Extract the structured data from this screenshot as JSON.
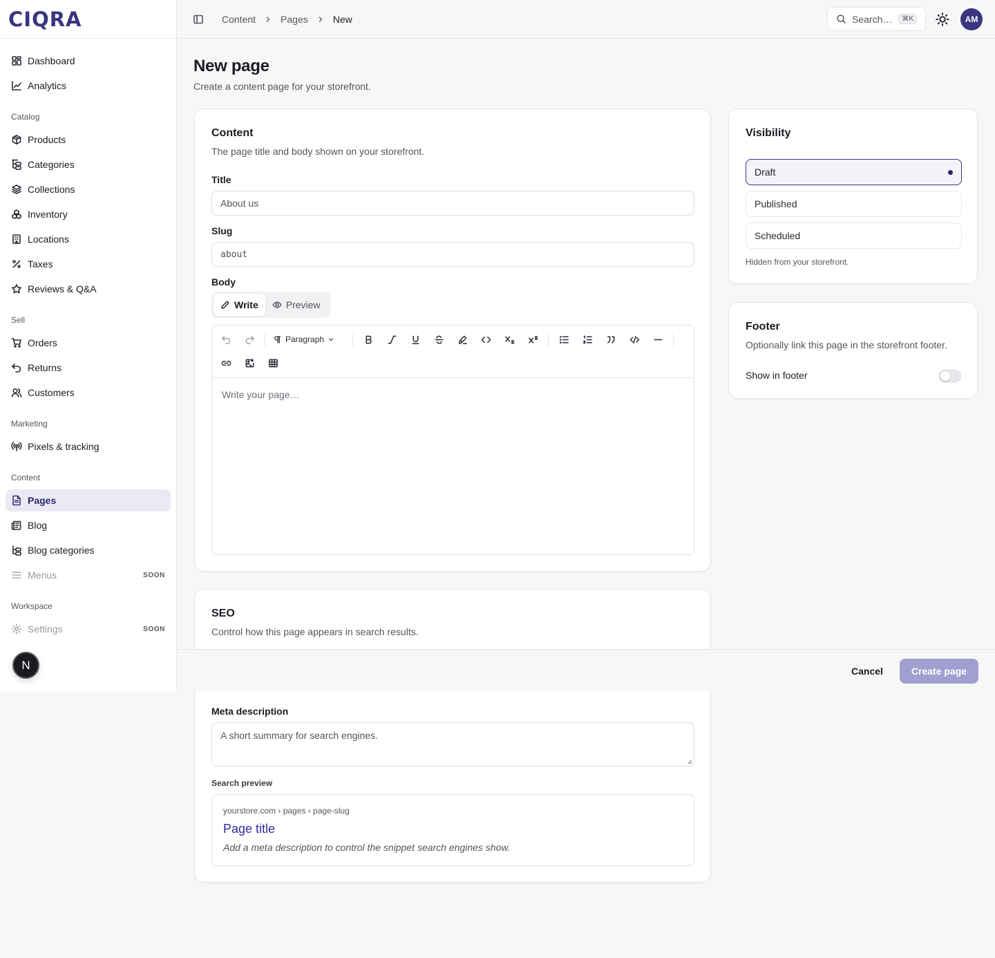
{
  "brand": {
    "logo": "CIQRA",
    "accent": "#3a357f"
  },
  "sidebar": {
    "top_items": [
      {
        "label": "Dashboard",
        "icon": "dashboard-icon"
      },
      {
        "label": "Analytics",
        "icon": "chart-line-icon"
      }
    ],
    "groups": [
      {
        "label": "Catalog",
        "items": [
          {
            "label": "Products",
            "icon": "box-icon"
          },
          {
            "label": "Categories",
            "icon": "tree-icon"
          },
          {
            "label": "Collections",
            "icon": "layers-icon"
          },
          {
            "label": "Inventory",
            "icon": "boxes-icon"
          },
          {
            "label": "Locations",
            "icon": "building-icon"
          },
          {
            "label": "Taxes",
            "icon": "percent-icon"
          },
          {
            "label": "Reviews & Q&A",
            "icon": "star-icon"
          }
        ]
      },
      {
        "label": "Sell",
        "items": [
          {
            "label": "Orders",
            "icon": "cart-icon"
          },
          {
            "label": "Returns",
            "icon": "return-icon"
          },
          {
            "label": "Customers",
            "icon": "users-icon"
          }
        ]
      },
      {
        "label": "Marketing",
        "items": [
          {
            "label": "Pixels & tracking",
            "icon": "radio-icon"
          }
        ]
      },
      {
        "label": "Content",
        "items": [
          {
            "label": "Pages",
            "icon": "file-icon",
            "active": true
          },
          {
            "label": "Blog",
            "icon": "newspaper-icon"
          },
          {
            "label": "Blog categories",
            "icon": "tree-icon"
          },
          {
            "label": "Menus",
            "icon": "menu-icon",
            "badge": "SOON",
            "disabled": true
          }
        ]
      },
      {
        "label": "Workspace",
        "items": [
          {
            "label": "Settings",
            "icon": "gear-icon",
            "badge": "SOON",
            "disabled": true
          }
        ]
      }
    ],
    "floating_badge": "N"
  },
  "header": {
    "breadcrumb": [
      "Content",
      "Pages",
      "New"
    ],
    "search_placeholder": "Search…",
    "search_shortcut": "⌘K",
    "avatar_initials": "AM"
  },
  "page": {
    "title": "New page",
    "subtitle": "Create a content page for your storefront."
  },
  "content_card": {
    "title": "Content",
    "description": "The page title and body shown on your storefront.",
    "title_label": "Title",
    "title_placeholder": "About us",
    "slug_label": "Slug",
    "slug_placeholder": "about",
    "body_label": "Body",
    "tabs": [
      {
        "label": "Write",
        "active": true
      },
      {
        "label": "Preview",
        "active": false
      }
    ],
    "toolbar": {
      "block_style": "Paragraph"
    },
    "editor_placeholder": "Write your page…"
  },
  "visibility_card": {
    "title": "Visibility",
    "options": [
      {
        "label": "Draft",
        "selected": true
      },
      {
        "label": "Published",
        "selected": false
      },
      {
        "label": "Scheduled",
        "selected": false
      }
    ],
    "hint": "Hidden from your storefront."
  },
  "footer_card": {
    "title": "Footer",
    "description": "Optionally link this page in the storefront footer.",
    "toggle_label": "Show in footer",
    "toggle_on": false
  },
  "seo_card": {
    "title": "SEO",
    "description": "Control how this page appears in search results.",
    "meta_label": "Meta description",
    "meta_placeholder": "A short summary for search engines.",
    "preview_label": "Search preview",
    "preview": {
      "url": "yourstore.com › pages › page-slug",
      "title": "Page title",
      "description": "Add a meta description to control the snippet search engines show."
    }
  },
  "actions": {
    "cancel": "Cancel",
    "create": "Create page"
  }
}
